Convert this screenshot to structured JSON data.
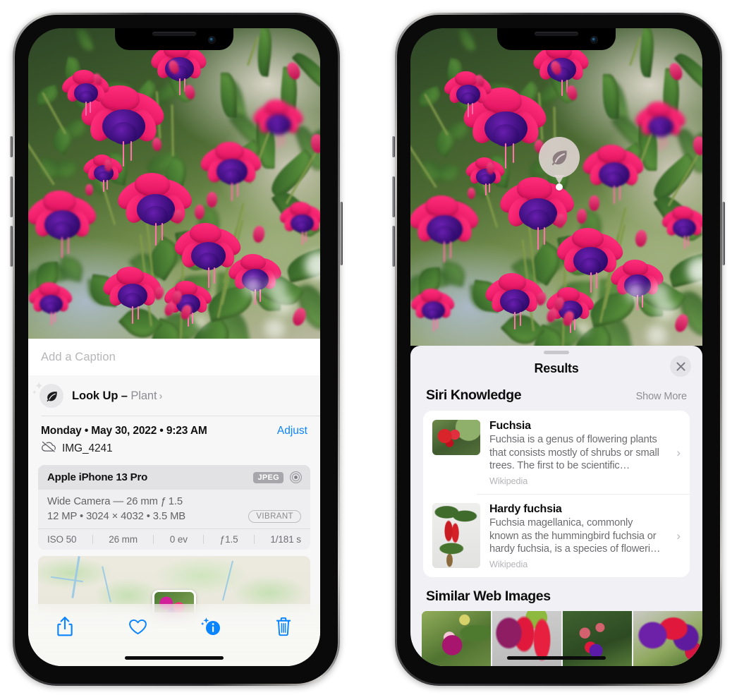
{
  "left_phone": {
    "caption_placeholder": "Add a Caption",
    "lookup": {
      "label": "Look Up – ",
      "subject": "Plant",
      "chevron": "›",
      "icon": "leaf-icon"
    },
    "metadata": {
      "date_line": "Monday • May 30, 2022 • 9:23 AM",
      "adjust_label": "Adjust",
      "filename": "IMG_4241",
      "cloud_icon": "icloud-slash-icon"
    },
    "exif": {
      "device": "Apple iPhone 13 Pro",
      "format_badge": "JPEG",
      "aperture_icon": "aperture-icon",
      "lens_line": "Wide Camera — 26 mm ƒ 1.5",
      "size_line": "12 MP • 3024 × 4032 • 3.5 MB",
      "style_badge": "VIBRANT",
      "stats": [
        "ISO 50",
        "26 mm",
        "0 ev",
        "ƒ1.5",
        "1/181 s"
      ]
    },
    "toolbar": [
      {
        "name": "share-button",
        "icon": "share-icon"
      },
      {
        "name": "favorite-button",
        "icon": "heart-icon"
      },
      {
        "name": "info-button",
        "icon": "info-sparkle-icon"
      },
      {
        "name": "delete-button",
        "icon": "trash-icon"
      }
    ]
  },
  "right_phone": {
    "visual_lookup_badge": {
      "icon": "leaf-icon"
    },
    "sheet": {
      "title": "Results",
      "close_icon": "close-icon",
      "siri_knowledge": {
        "title": "Siri Knowledge",
        "show_more": "Show More",
        "items": [
          {
            "title": "Fuchsia",
            "description": "Fuchsia is a genus of flowering plants that consists mostly of shrubs or small trees. The first to be scientific…",
            "source": "Wikipedia",
            "chevron": "›"
          },
          {
            "title": "Hardy fuchsia",
            "description": "Fuchsia magellanica, commonly known as the hummingbird fuchsia or hardy fuchsia, is a species of floweri…",
            "source": "Wikipedia",
            "chevron": "›"
          }
        ]
      },
      "similar_web_images": {
        "title": "Similar Web Images",
        "tiles": [
          {
            "name": "similar-image-1"
          },
          {
            "name": "similar-image-2"
          },
          {
            "name": "similar-image-3"
          },
          {
            "name": "similar-image-4"
          }
        ]
      }
    }
  },
  "colors": {
    "accent_blue": "#0a84ff",
    "sheet_bg": "#f1f1f5",
    "panel_bg": "#f7f7f7",
    "secondary_text": "#8e8e93"
  }
}
